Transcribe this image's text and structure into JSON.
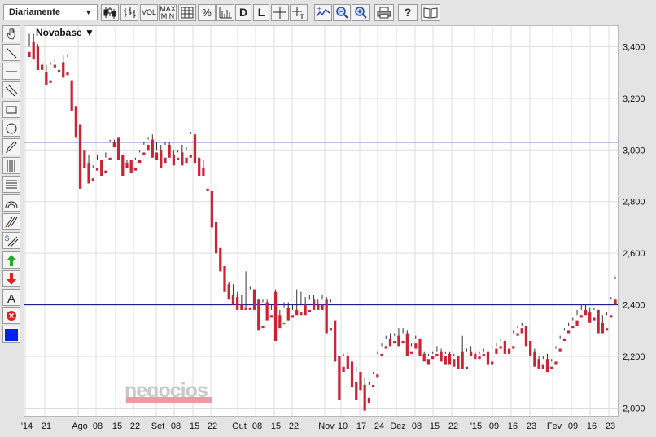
{
  "toolbar": {
    "period_select": "Diariamente",
    "buttons": {
      "candles": "candles-icon",
      "ohlc": "ohlc-bars-icon",
      "vol": "VOL",
      "maxmin_top": "MAX",
      "maxmin_bottom": "MIN",
      "grid": "grid-icon",
      "percent": "%",
      "area": "area-chart-icon",
      "d": "D",
      "l": "L",
      "crosshair": "crosshair-icon",
      "cross_tl": "crosshair-label-icon",
      "indicator": "indicator-icon",
      "zoom_out": "zoom-out-icon",
      "zoom_in": "zoom-in-icon",
      "print": "print-icon",
      "help": "?",
      "book": "book-icon"
    }
  },
  "left_tools": [
    "hand-icon",
    "line-icon",
    "horizontal-line-icon",
    "parallel-lines-icon",
    "rectangle-icon",
    "ellipse-icon",
    "pencil-icon",
    "fibonacci-retracement-icon",
    "fibonacci-levels-icon",
    "arc-icon",
    "fan-lines-icon",
    "dollar-channel-icon",
    "arrow-up-icon",
    "arrow-down-icon",
    "text-icon",
    "delete-icon",
    "color-swatch-icon"
  ],
  "colors": {
    "up": "#22bb22",
    "down": "#cc2233",
    "hline": "#00008b",
    "grid": "#dcdcdc",
    "swatch": "#0022ee"
  },
  "watermark": "negocios",
  "chart_data": {
    "type": "candlestick",
    "instrument": "Novabase ▼",
    "x_ticks": [
      "'14",
      "21",
      "Ago",
      "08",
      "15",
      "22",
      "Set",
      "08",
      "15",
      "22",
      "Out",
      "08",
      "15",
      "22",
      "Nov",
      "10",
      "17",
      "24",
      "Dez",
      "08",
      "15",
      "22",
      "'15",
      "09",
      "16",
      "23",
      "Fev",
      "09",
      "16",
      "23"
    ],
    "y_ticks": [
      "2,000",
      "2,200",
      "2,400",
      "2,600",
      "2,800",
      "3,000",
      "3,200",
      "3,400"
    ],
    "ylim": [
      1.97,
      3.48
    ],
    "horizontal_lines": [
      3.03,
      2.4
    ],
    "grid": true,
    "ohlc": [
      [
        3.38,
        3.45,
        3.4,
        3.36
      ],
      [
        3.42,
        3.45,
        3.38,
        3.35
      ],
      [
        3.4,
        3.41,
        3.33,
        3.31
      ],
      [
        3.33,
        3.34,
        3.32,
        3.31
      ],
      [
        3.3,
        3.33,
        3.26,
        3.25
      ],
      [
        3.27,
        3.34,
        3.33,
        3.26
      ],
      [
        3.33,
        3.35,
        3.34,
        3.32
      ],
      [
        3.31,
        3.35,
        3.33,
        3.3
      ],
      [
        3.34,
        3.37,
        3.3,
        3.28
      ],
      [
        3.3,
        3.37,
        3.36,
        3.29
      ],
      [
        3.27,
        3.27,
        3.17,
        3.15
      ],
      [
        3.17,
        3.17,
        3.1,
        3.05
      ],
      [
        3.1,
        3.1,
        3.0,
        2.85
      ],
      [
        3.0,
        3.0,
        2.95,
        2.93
      ],
      [
        2.95,
        2.98,
        2.9,
        2.87
      ],
      [
        2.89,
        2.94,
        2.93,
        2.88
      ],
      [
        2.93,
        2.98,
        2.96,
        2.92
      ],
      [
        2.96,
        2.96,
        2.92,
        2.9
      ],
      [
        2.92,
        2.99,
        2.97,
        2.91
      ],
      [
        2.97,
        3.04,
        3.03,
        2.96
      ],
      [
        3.03,
        3.04,
        3.02,
        3.01
      ],
      [
        3.05,
        3.05,
        2.98,
        2.96
      ],
      [
        2.98,
        2.98,
        2.95,
        2.9
      ],
      [
        2.95,
        2.96,
        2.94,
        2.93
      ],
      [
        2.96,
        2.96,
        2.93,
        2.91
      ],
      [
        2.93,
        2.97,
        2.96,
        2.92
      ],
      [
        2.96,
        3.0,
        2.99,
        2.95
      ],
      [
        2.99,
        3.03,
        3.02,
        2.98
      ],
      [
        3.02,
        3.05,
        3.04,
        3.0
      ],
      [
        3.04,
        3.06,
        2.99,
        2.97
      ],
      [
        2.99,
        3.03,
        3.0,
        2.96
      ],
      [
        3.0,
        3.02,
        2.97,
        2.93
      ],
      [
        2.97,
        3.03,
        3.02,
        2.95
      ],
      [
        3.02,
        3.03,
        2.99,
        2.97
      ],
      [
        2.98,
        3.0,
        2.97,
        2.94
      ],
      [
        2.97,
        3.0,
        2.99,
        2.96
      ],
      [
        2.99,
        3.02,
        2.97,
        2.94
      ],
      [
        2.97,
        3.01,
        3.0,
        2.95
      ],
      [
        2.98,
        3.07,
        3.06,
        2.97
      ],
      [
        3.06,
        3.06,
        2.97,
        2.95
      ],
      [
        2.97,
        2.97,
        2.93,
        2.9
      ],
      [
        2.93,
        2.96,
        2.91,
        2.9
      ],
      [
        2.85,
        2.85,
        2.84,
        2.84
      ],
      [
        2.84,
        2.84,
        2.72,
        2.7
      ],
      [
        2.72,
        2.72,
        2.62,
        2.6
      ],
      [
        2.62,
        2.62,
        2.55,
        2.53
      ],
      [
        2.55,
        2.55,
        2.48,
        2.45
      ],
      [
        2.48,
        2.49,
        2.44,
        2.42
      ],
      [
        2.44,
        2.48,
        2.43,
        2.4
      ],
      [
        2.43,
        2.45,
        2.4,
        2.38
      ],
      [
        2.4,
        2.44,
        2.39,
        2.38
      ],
      [
        2.39,
        2.53,
        2.39,
        2.38
      ],
      [
        2.39,
        2.47,
        2.46,
        2.38
      ],
      [
        2.46,
        2.46,
        2.42,
        2.38
      ],
      [
        2.42,
        2.42,
        2.32,
        2.3
      ],
      [
        2.32,
        2.42,
        2.41,
        2.31
      ],
      [
        2.41,
        2.42,
        2.36,
        2.34
      ],
      [
        2.36,
        2.4,
        2.38,
        2.35
      ],
      [
        2.45,
        2.46,
        2.36,
        2.26
      ],
      [
        2.36,
        2.38,
        2.33,
        2.31
      ],
      [
        2.33,
        2.41,
        2.39,
        2.33
      ],
      [
        2.39,
        2.41,
        2.36,
        2.34
      ],
      [
        2.36,
        2.4,
        2.38,
        2.35
      ],
      [
        2.38,
        2.46,
        2.37,
        2.36
      ],
      [
        2.37,
        2.45,
        2.4,
        2.36
      ],
      [
        2.4,
        2.43,
        2.38,
        2.36
      ],
      [
        2.38,
        2.44,
        2.42,
        2.37
      ],
      [
        2.42,
        2.44,
        2.4,
        2.38
      ],
      [
        2.4,
        2.42,
        2.39,
        2.38
      ],
      [
        2.4,
        2.44,
        2.42,
        2.38
      ],
      [
        2.42,
        2.43,
        2.3,
        2.29
      ],
      [
        2.31,
        2.42,
        2.41,
        2.3
      ],
      [
        2.34,
        2.34,
        2.2,
        2.18
      ],
      [
        2.2,
        2.2,
        2.16,
        2.03
      ],
      [
        2.16,
        2.21,
        2.2,
        2.14
      ],
      [
        2.2,
        2.22,
        2.18,
        2.15
      ],
      [
        2.18,
        2.18,
        2.1,
        2.08
      ],
      [
        2.1,
        2.16,
        2.14,
        2.03
      ],
      [
        2.14,
        2.14,
        2.09,
        2.07
      ],
      [
        2.09,
        2.12,
        2.04,
        1.99
      ],
      [
        2.04,
        2.1,
        2.09,
        2.02
      ],
      [
        2.09,
        2.14,
        2.13,
        2.08
      ],
      [
        2.13,
        2.22,
        2.21,
        2.12
      ],
      [
        2.21,
        2.25,
        2.24,
        2.2
      ],
      [
        2.24,
        2.28,
        2.27,
        2.23
      ],
      [
        2.27,
        2.29,
        2.26,
        2.24
      ],
      [
        2.26,
        2.29,
        2.28,
        2.25
      ],
      [
        2.28,
        2.31,
        2.26,
        2.24
      ],
      [
        2.26,
        2.31,
        2.29,
        2.25
      ],
      [
        2.29,
        2.3,
        2.22,
        2.2
      ],
      [
        2.22,
        2.25,
        2.24,
        2.21
      ],
      [
        2.25,
        2.28,
        2.27,
        2.23
      ],
      [
        2.27,
        2.27,
        2.21,
        2.2
      ],
      [
        2.21,
        2.22,
        2.19,
        2.18
      ],
      [
        2.19,
        2.21,
        2.2,
        2.17
      ],
      [
        2.2,
        2.22,
        2.21,
        2.19
      ],
      [
        2.21,
        2.24,
        2.22,
        2.2
      ],
      [
        2.22,
        2.23,
        2.2,
        2.18
      ],
      [
        2.2,
        2.22,
        2.21,
        2.17
      ],
      [
        2.21,
        2.22,
        2.19,
        2.17
      ],
      [
        2.19,
        2.21,
        2.2,
        2.16
      ],
      [
        2.2,
        2.2,
        2.17,
        2.15
      ],
      [
        2.22,
        2.28,
        2.15,
        2.15
      ],
      [
        2.16,
        2.23,
        2.22,
        2.15
      ],
      [
        2.22,
        2.24,
        2.21,
        2.2
      ],
      [
        2.21,
        2.22,
        2.2,
        2.19
      ],
      [
        2.2,
        2.22,
        2.21,
        2.19
      ],
      [
        2.21,
        2.23,
        2.22,
        2.2
      ],
      [
        2.22,
        2.22,
        2.18,
        2.17
      ],
      [
        2.18,
        2.24,
        2.23,
        2.17
      ],
      [
        2.23,
        2.25,
        2.24,
        2.21
      ],
      [
        2.24,
        2.27,
        2.26,
        2.23
      ],
      [
        2.26,
        2.27,
        2.23,
        2.21
      ],
      [
        2.23,
        2.26,
        2.24,
        2.21
      ],
      [
        2.24,
        2.3,
        2.29,
        2.23
      ],
      [
        2.29,
        2.32,
        2.31,
        2.28
      ],
      [
        2.31,
        2.33,
        2.32,
        2.29
      ],
      [
        2.32,
        2.32,
        2.26,
        2.24
      ],
      [
        2.26,
        2.26,
        2.22,
        2.2
      ],
      [
        2.22,
        2.23,
        2.19,
        2.16
      ],
      [
        2.19,
        2.2,
        2.17,
        2.15
      ],
      [
        2.17,
        2.2,
        2.19,
        2.15
      ],
      [
        2.19,
        2.21,
        2.16,
        2.14
      ],
      [
        2.16,
        2.19,
        2.18,
        2.15
      ],
      [
        2.18,
        2.24,
        2.23,
        2.17
      ],
      [
        2.23,
        2.28,
        2.27,
        2.22
      ],
      [
        2.27,
        2.31,
        2.3,
        2.26
      ],
      [
        2.3,
        2.33,
        2.32,
        2.29
      ],
      [
        2.32,
        2.35,
        2.34,
        2.31
      ],
      [
        2.34,
        2.38,
        2.36,
        2.32
      ],
      [
        2.36,
        2.4,
        2.38,
        2.35
      ],
      [
        2.38,
        2.4,
        2.37,
        2.36
      ],
      [
        2.37,
        2.39,
        2.35,
        2.33
      ],
      [
        2.35,
        2.39,
        2.38,
        2.34
      ],
      [
        2.38,
        2.38,
        2.34,
        2.29
      ],
      [
        2.33,
        2.36,
        2.31,
        2.29
      ],
      [
        2.31,
        2.37,
        2.36,
        2.3
      ],
      [
        2.36,
        2.43,
        2.42,
        2.35
      ],
      [
        2.42,
        2.51,
        2.5,
        2.4
      ]
    ]
  }
}
